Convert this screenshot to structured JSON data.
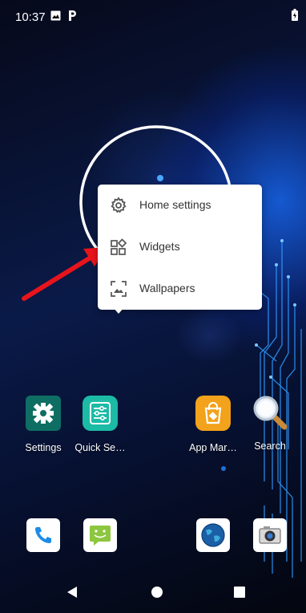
{
  "status_bar": {
    "time": "10:37",
    "icons": [
      "image-icon",
      "parking-app-icon",
      "battery-charging-icon"
    ]
  },
  "context_menu": {
    "items": [
      {
        "label": "Home settings",
        "icon": "gear-icon"
      },
      {
        "label": "Widgets",
        "icon": "widgets-icon"
      },
      {
        "label": "Wallpapers",
        "icon": "wallpaper-icon"
      }
    ]
  },
  "home_apps": [
    {
      "label": "Settings",
      "icon": "settings-gear-icon",
      "color": "#0f6e63"
    },
    {
      "label": "Quick Se…",
      "icon": "quick-settings-sliders-icon",
      "color": "#1bbba6"
    },
    {
      "label": "App Mar…",
      "icon": "shopping-bag-icon",
      "color": "#f2a21b"
    },
    {
      "label": "Search",
      "icon": "magnifier-icon",
      "color": "#dfe6ee"
    }
  ],
  "dock": [
    {
      "name": "phone",
      "icon": "phone-icon",
      "color": "#1e8ce6"
    },
    {
      "name": "messaging",
      "icon": "message-icon",
      "color": "#8dc63f"
    },
    {
      "name": "browser",
      "icon": "globe-icon",
      "color": "#1b5fa6"
    },
    {
      "name": "camera",
      "icon": "camera-icon",
      "color": "#555555"
    }
  ],
  "nav_bar": {
    "buttons": [
      "back-icon",
      "home-icon",
      "recents-icon"
    ]
  },
  "colors": {
    "arrow": "#e8141c",
    "menu_bg": "#ffffff",
    "menu_text": "#333333"
  }
}
